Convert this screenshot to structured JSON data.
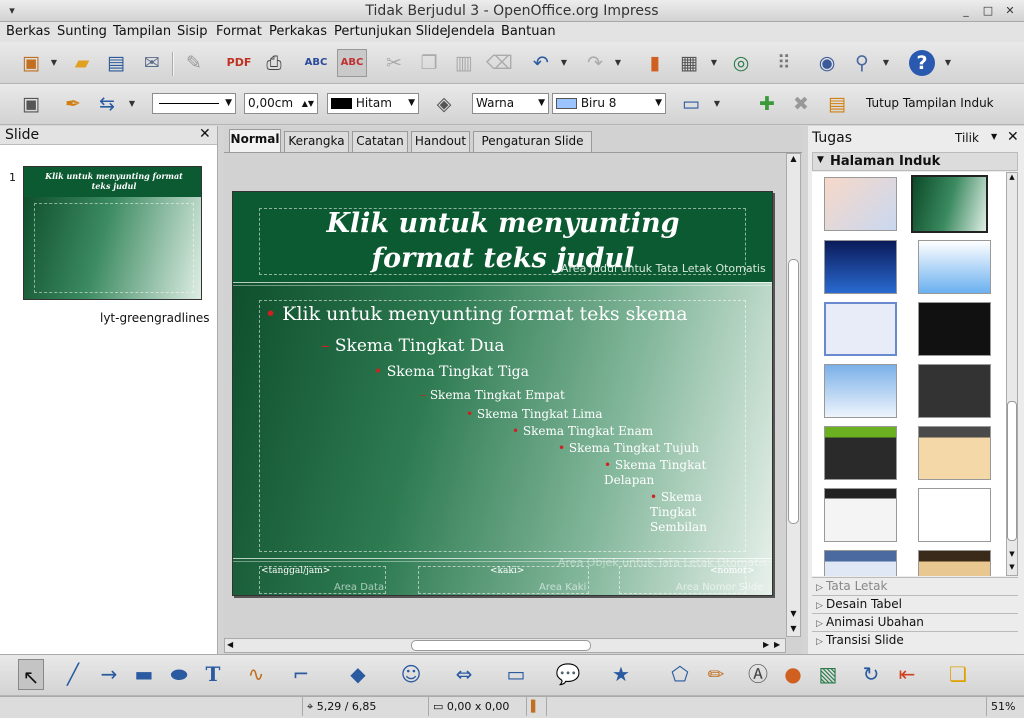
{
  "window": {
    "title": "Tidak Berjudul 3 - OpenOffice.org Impress"
  },
  "menu": [
    "Berkas",
    "Sunting",
    "Tampilan",
    "Sisip",
    "Format",
    "Perkakas",
    "Pertunjukan Slide",
    "Jendela",
    "Bantuan"
  ],
  "line_toolbar": {
    "line_width": "0,00cm",
    "line_color": "Hitam",
    "area_style": "Warna",
    "area_color": "Biru 8",
    "close_master": "Tutup Tampilan Induk"
  },
  "slides_pane": {
    "title": "Slide",
    "slide_number": "1",
    "layout_name": "lyt-greengradlines",
    "thumb_title": "Klik untuk menyunting format teks judul"
  },
  "tabs": [
    "Normal",
    "Kerangka",
    "Catatan",
    "Handout",
    "Pengaturan Slide"
  ],
  "slide": {
    "title": "Klik untuk menyunting format teks judul",
    "title_area_label": "Area Judul untuk Tata Letak Otomatis",
    "outline": [
      "Klik untuk menyunting format teks skema",
      "Skema Tingkat Dua",
      "Skema Tingkat Tiga",
      "Skema Tingkat Empat",
      "Skema Tingkat Lima",
      "Skema Tingkat Enam",
      "Skema Tingkat Tujuh",
      "Skema Tingkat Delapan",
      "Skema Tingkat Sembilan"
    ],
    "object_area_label": "Area Objek untuk Tata Letak Otomatis",
    "date_field": "<tanggal/jam>",
    "date_label": "Area Data",
    "footer_field": "<kaki>",
    "footer_label": "Area Kaki",
    "number_field": "<nomor>",
    "number_label": "Area Nomor Slide"
  },
  "tasks": {
    "title": "Tugas",
    "view_label": "Tilik",
    "master_pages": "Halaman Induk",
    "sections": [
      "Tata Letak",
      "Desain Tabel",
      "Animasi Ubahan",
      "Transisi Slide"
    ]
  },
  "status": {
    "position": "5,29 / 6,85",
    "size": "0,00 x 0,00",
    "zoom": "51%"
  },
  "colors": {
    "slide_green": "#0b5a32",
    "bullet": "#d02020",
    "selection": "#1a3b78"
  }
}
